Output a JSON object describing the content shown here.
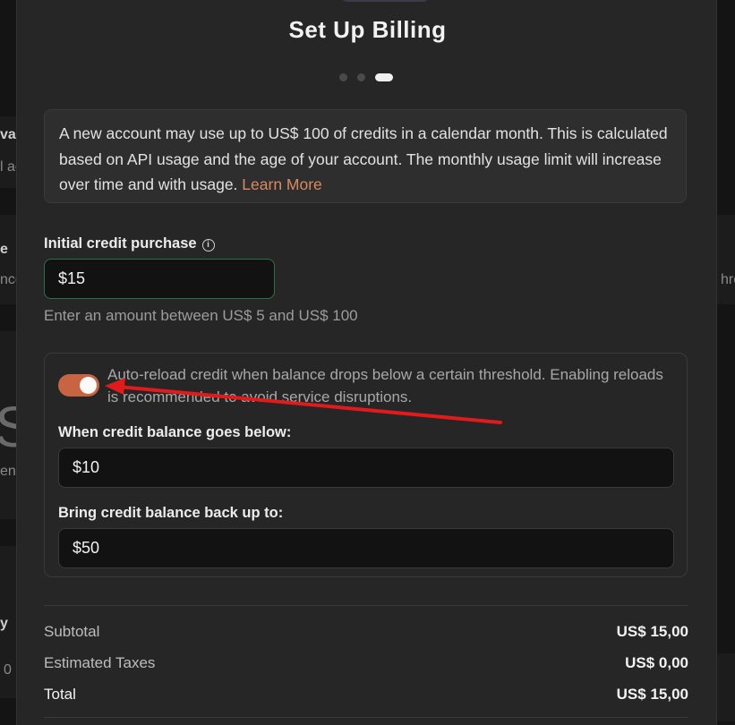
{
  "modal": {
    "title": "Set Up Billing",
    "steps": {
      "count": 3,
      "active": 3
    }
  },
  "notice": {
    "text": "A new account may use up to US$ 100 of credits in a calendar month. This is calculated based on API usage and the age of your account. The monthly usage limit will increase over time and with usage.",
    "link_label": "Learn More"
  },
  "initial_purchase": {
    "label": "Initial credit purchase",
    "info_icon": "info-circle-icon",
    "value": "$15",
    "helper": "Enter an amount between US$ 5 and US$ 100"
  },
  "auto_reload": {
    "enabled": true,
    "description": "Auto-reload credit when balance drops below a certain threshold. Enabling reloads is recommended to avoid service disruptions.",
    "threshold_label": "When credit balance goes below:",
    "threshold_value": "$10",
    "target_label": "Bring credit balance back up to:",
    "target_value": "$50"
  },
  "summary": {
    "subtotal_label": "Subtotal",
    "subtotal_value": "US$ 15,00",
    "taxes_label": "Estimated Taxes",
    "taxes_value": "US$ 0,00",
    "total_label": "Total",
    "total_value": "US$ 15,00"
  },
  "background": {
    "fragments": [
      "val",
      "l ac",
      "e",
      "nce",
      "hre",
      "S",
      "en",
      "y",
      "0"
    ]
  },
  "colors": {
    "accent": "#c96442",
    "link": "#d98a62",
    "annotation_arrow": "#e01b1b",
    "modal_bg": "#262626"
  }
}
